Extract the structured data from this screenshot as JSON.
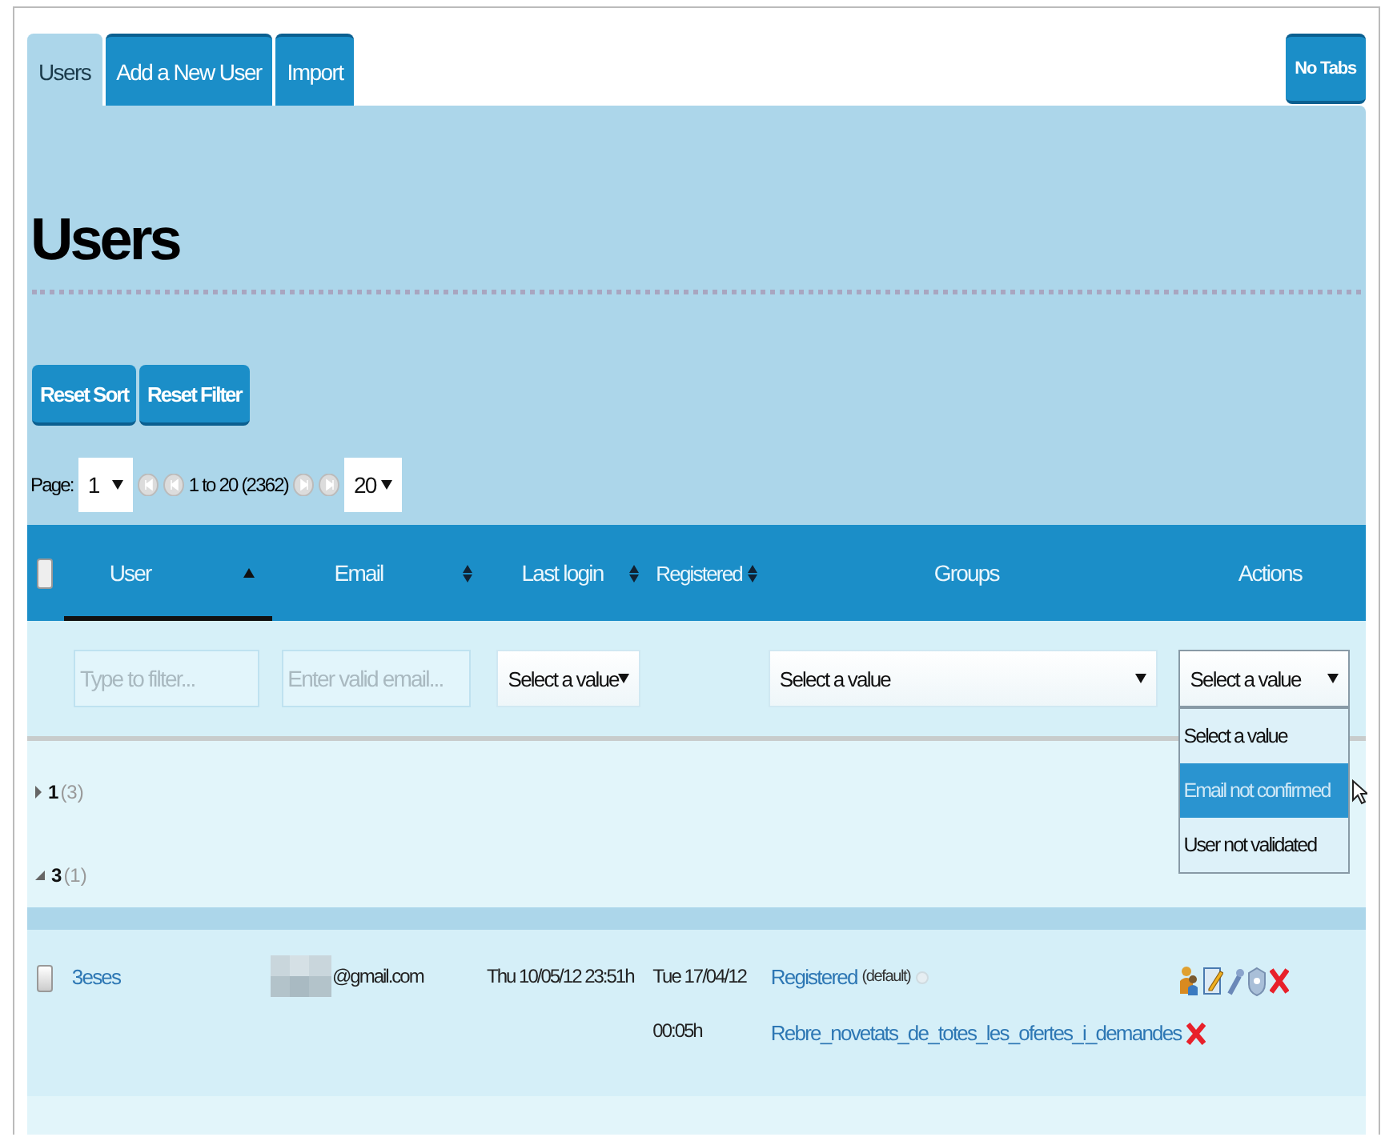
{
  "tabs": [
    {
      "label": "Users",
      "selected": true
    },
    {
      "label": "Add a New User",
      "selected": false
    },
    {
      "label": "Import",
      "selected": false
    }
  ],
  "no_tabs_button": "No Tabs",
  "heading": "Users",
  "buttons": [
    "Reset Sort",
    "Reset Filter"
  ],
  "pager": {
    "label": "Page:",
    "page": "1",
    "range": "1 to 20 (2362)",
    "page_size": "20"
  },
  "table": {
    "select_all_checked": false,
    "columns": [
      {
        "label": "User",
        "sortable": true,
        "sorted": true
      },
      {
        "label": "Email",
        "sortable": true,
        "sorted": false
      },
      {
        "label": "Last login",
        "sortable": true,
        "sorted": false
      },
      {
        "label": "Registered",
        "sortable": true,
        "sorted": false
      },
      {
        "label": "Groups",
        "sortable": false,
        "sorted": false
      },
      {
        "label": "Actions",
        "sortable": false,
        "sorted": false
      }
    ],
    "filters": [
      {
        "kind": "text",
        "placeholder": "Type to filter..."
      },
      {
        "kind": "text",
        "placeholder": "Enter valid email..."
      },
      {
        "kind": "select",
        "value": "Select a value"
      },
      {
        "kind": "empty"
      },
      {
        "kind": "select",
        "value": "Select a value"
      },
      {
        "kind": "select",
        "value": "Select a value",
        "options": [
          {
            "label": "Select a value",
            "highlighted": false
          },
          {
            "label": "Email not confirmed",
            "highlighted": true
          },
          {
            "label": "User not validated",
            "highlighted": false
          }
        ]
      }
    ],
    "groups": [
      {
        "label": "1",
        "count": "(3)",
        "expanded": false
      },
      {
        "label": "3",
        "count": "(1)",
        "expanded": true,
        "rows": [
          {
            "checked": false,
            "user": "3eses",
            "email": "@gmail.com",
            "last_login": "Thu 10/05/12 23:51h",
            "registered": "Tue 17/04/12 00:05h",
            "groups": [
              {
                "name": "Registered",
                "note": "(default)"
              },
              {
                "name": "Rebre_novetats_de_totes_les_ofertes_i_demandes"
              }
            ]
          }
        ]
      }
    ]
  }
}
